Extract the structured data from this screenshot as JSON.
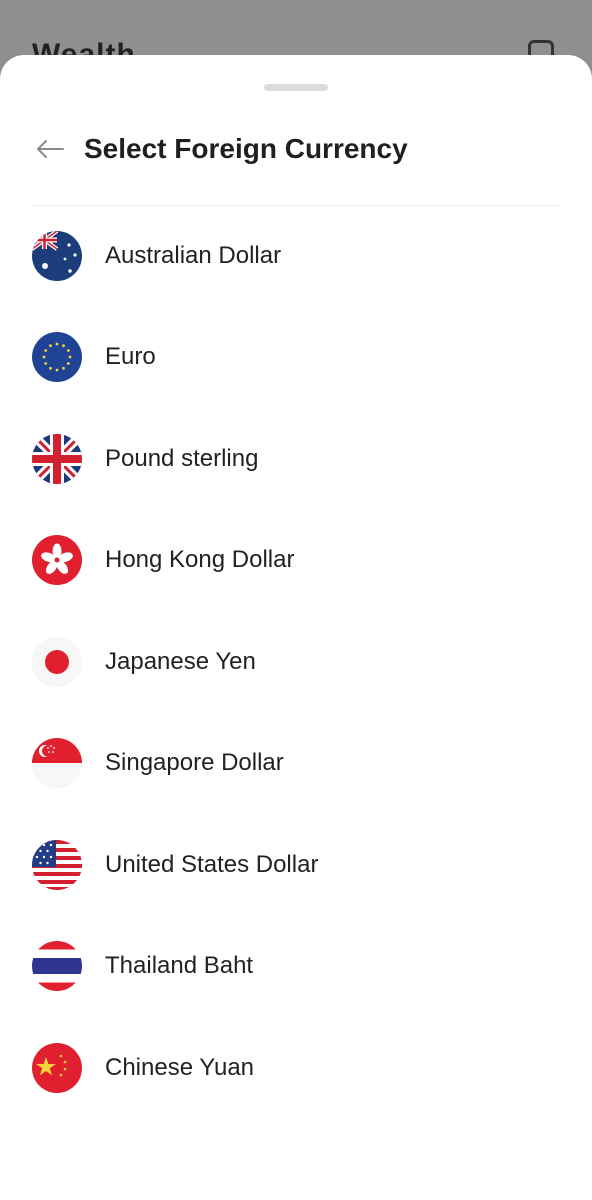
{
  "background": {
    "title": "Wealth..."
  },
  "header": {
    "title": "Select Foreign Currency"
  },
  "currencies": [
    {
      "name": "Australian Dollar",
      "flag_icon": "australia-flag-icon"
    },
    {
      "name": "Euro",
      "flag_icon": "eu-flag-icon"
    },
    {
      "name": "Pound sterling",
      "flag_icon": "uk-flag-icon"
    },
    {
      "name": "Hong Kong Dollar",
      "flag_icon": "hong-kong-flag-icon"
    },
    {
      "name": "Japanese Yen",
      "flag_icon": "japan-flag-icon"
    },
    {
      "name": "Singapore Dollar",
      "flag_icon": "singapore-flag-icon"
    },
    {
      "name": "United States Dollar",
      "flag_icon": "usa-flag-icon"
    },
    {
      "name": "Thailand Baht",
      "flag_icon": "thailand-flag-icon"
    },
    {
      "name": "Chinese Yuan",
      "flag_icon": "china-flag-icon"
    }
  ],
  "colors": {
    "sheet": "#ffffff",
    "text": "#222222",
    "backdrop": "#8f8f8f"
  }
}
